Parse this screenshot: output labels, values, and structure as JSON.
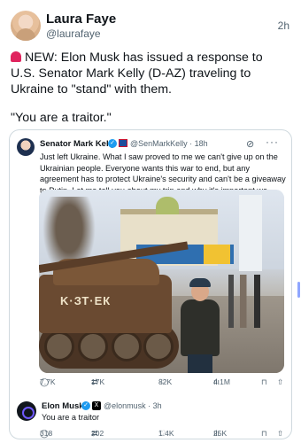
{
  "post": {
    "author_name": "Laura Faye",
    "author_handle": "@laurafaye",
    "time": "2h",
    "text_line1": "NEW: Elon Musk has issued a response to U.S. Senator Mark Kelly (D-AZ) traveling to Ukraine to \"stand\" with them.",
    "text_line2": "\"You are a traitor.\""
  },
  "quote": {
    "name": "Senator Mark Kelly",
    "handle_time": "@SenMarkKelly · 18h",
    "text": "Just left Ukraine. What I saw proved to me we can't give up on the Ukrainian people. Everyone wants this war to end, but any agreement has to protect Ukraine's security and can't be a giveaway to Putin. Let me tell you about my trip and why it's important we stand with Ukraine.",
    "media_graffiti": "K·ЗТ·ЕК",
    "metrics": {
      "replies": "7.7K",
      "reposts": "17K",
      "likes": "82K",
      "views": "4.1M"
    }
  },
  "reply": {
    "name": "Elon Musk",
    "handle_time": "@elonmusk · 3h",
    "text": "You are a traitor",
    "metrics": {
      "replies": "318",
      "reposts": "202",
      "likes": "1.4K",
      "views": "25K"
    }
  },
  "icons": {
    "reply": "reply-icon",
    "repost": "repost-icon",
    "like": "heart-icon",
    "views": "views-icon",
    "bookmark": "bookmark-icon",
    "share": "share-icon",
    "more": "more-icon",
    "grok": "grok-icon"
  },
  "colors": {
    "verified": "#1d9bf0",
    "secondary_text": "#536471",
    "border": "#cfd9de"
  }
}
